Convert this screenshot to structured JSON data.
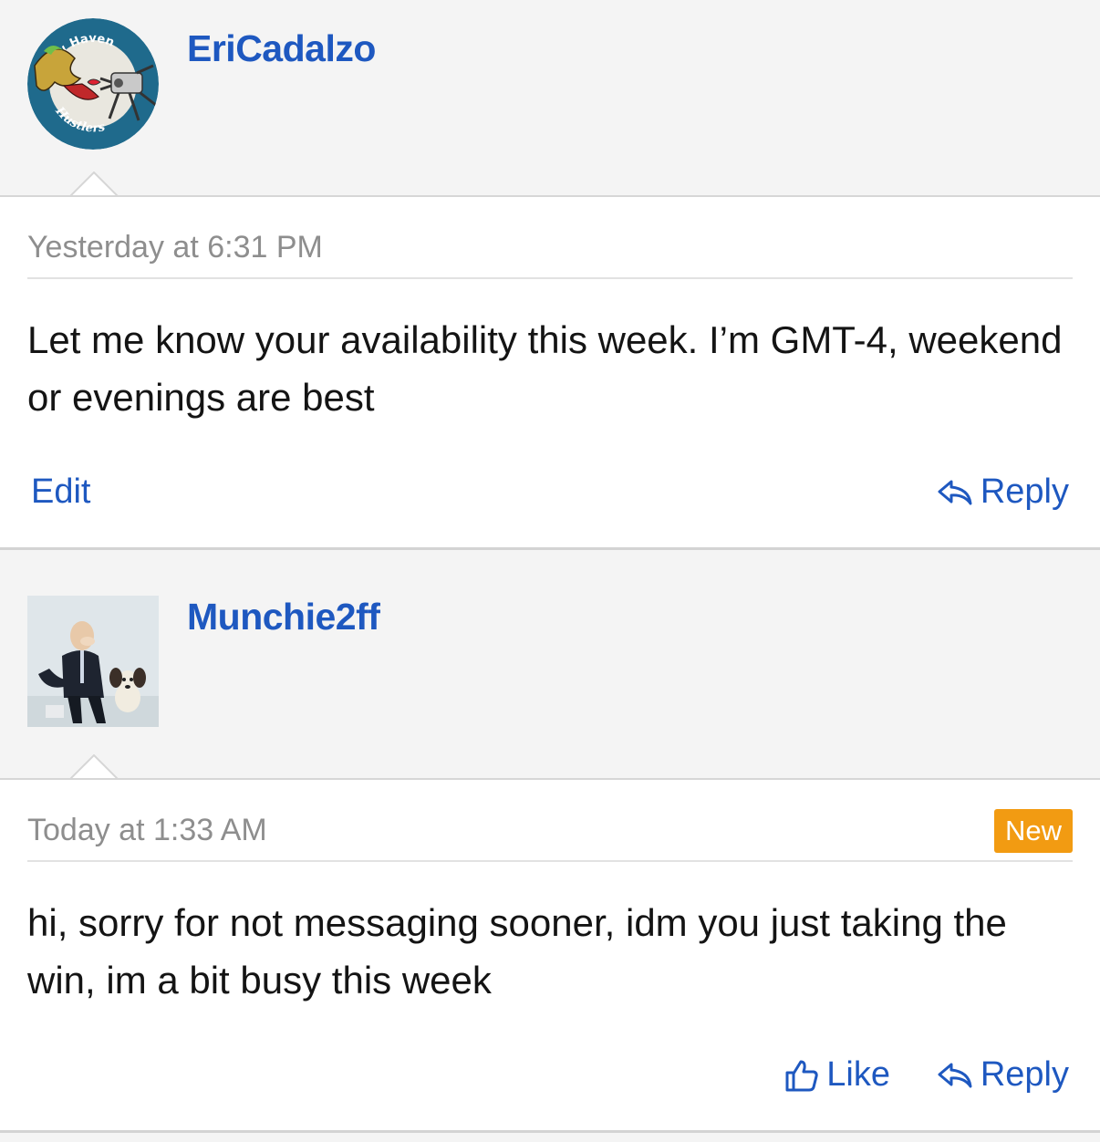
{
  "posts": [
    {
      "username": "EriCadalzo",
      "avatar_text": {
        "top": "New Haven",
        "bottom": "Hustlers"
      },
      "timestamp": "Yesterday at 6:31 PM",
      "message": "Let me know your availability this week. I’m GMT-4, weekend or evenings are best",
      "actions": {
        "edit": "Edit",
        "reply": "Reply"
      }
    },
    {
      "username": "Munchie2ff",
      "timestamp": "Today at 1:33 AM",
      "badge": "New",
      "message": "hi, sorry for not messaging sooner, idm you just taking the win, im a bit busy this week",
      "actions": {
        "like": "Like",
        "reply": "Reply"
      }
    }
  ],
  "colors": {
    "link": "#1e58c0",
    "badge": "#f29b12",
    "meta": "#8e8e8e"
  }
}
